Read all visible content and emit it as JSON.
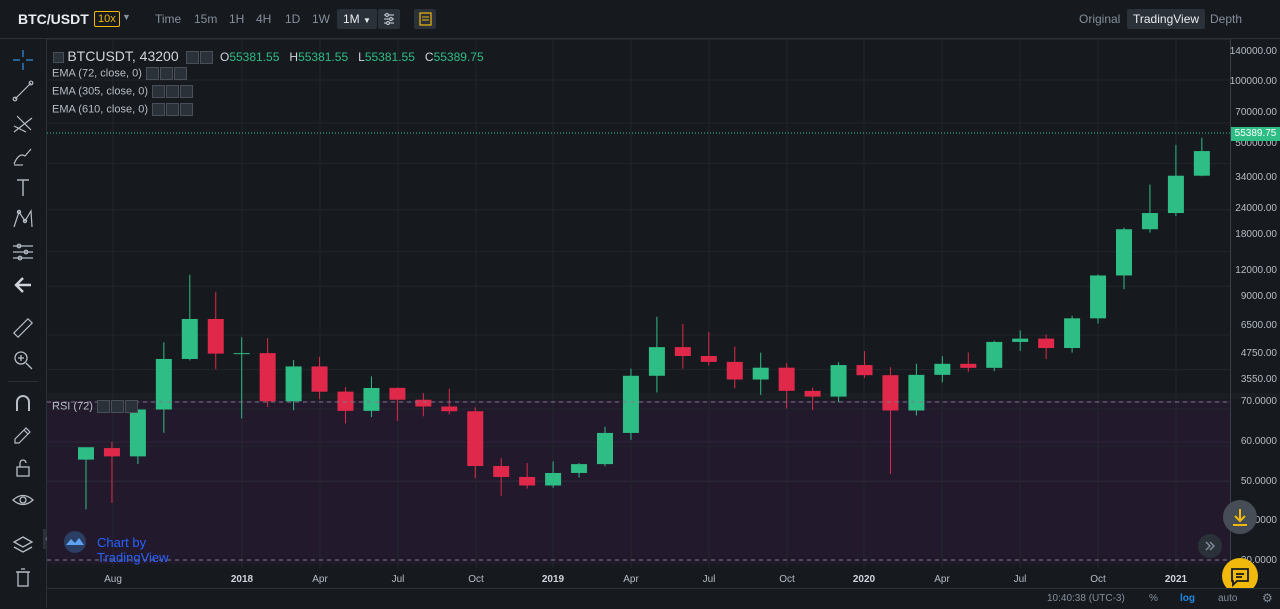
{
  "header": {
    "pair": "BTC/USDT",
    "leverage": "10x",
    "intervals": [
      "Time",
      "15m",
      "1H",
      "4H",
      "1D",
      "1W"
    ],
    "active_interval": "1M",
    "views": [
      "Original",
      "TradingView",
      "Depth"
    ],
    "active_view": "TradingView"
  },
  "legend": {
    "symbol": "BTCUSDT, 43200",
    "o_label": "O",
    "o_value": "55381.55",
    "h_label": "H",
    "h_value": "55381.55",
    "l_label": "L",
    "l_value": "55381.55",
    "c_label": "C",
    "c_value": "55389.75",
    "ema1": "EMA (72, close, 0)",
    "ema2": "EMA (305, close, 0)",
    "ema3": "EMA (610, close, 0)",
    "rsi": "RSI (72)"
  },
  "price_axis": [
    "140000.00",
    "100000.00",
    "70000.00",
    "50000.00",
    "34000.00",
    "24000.00",
    "18000.00",
    "12000.00",
    "9000.00",
    "6500.00",
    "4750.00",
    "3550.00"
  ],
  "current_price": "55389.75",
  "rsi_axis": [
    "70.0000",
    "60.0000",
    "50.0000",
    "40.0000"
  ],
  "rsi_hidden_label": "30.0000",
  "time_axis": [
    {
      "label": "Aug",
      "bold": false
    },
    {
      "label": "2018",
      "bold": true
    },
    {
      "label": "Apr",
      "bold": false
    },
    {
      "label": "Jul",
      "bold": false
    },
    {
      "label": "Oct",
      "bold": false
    },
    {
      "label": "2019",
      "bold": true
    },
    {
      "label": "Apr",
      "bold": false
    },
    {
      "label": "Jul",
      "bold": false
    },
    {
      "label": "Oct",
      "bold": false
    },
    {
      "label": "2020",
      "bold": true
    },
    {
      "label": "Apr",
      "bold": false
    },
    {
      "label": "Jul",
      "bold": false
    },
    {
      "label": "Oct",
      "bold": false
    },
    {
      "label": "2021",
      "bold": true
    }
  ],
  "watermark": "Chart by TradingView",
  "status": {
    "time": "10:40:38 (UTC-3)",
    "percent": "%",
    "log": "log",
    "auto": "auto"
  },
  "colors": {
    "up": "#2ebd85",
    "down": "#e0294a",
    "accent": "#f0b90b"
  },
  "chart_data": {
    "type": "candlestick",
    "symbol": "BTCUSDT",
    "interval": "1M",
    "scale": "log",
    "candles": [
      {
        "t": "2017-08",
        "o": 4261,
        "h": 4485,
        "l": 2817,
        "c": 4724
      },
      {
        "t": "2017-09",
        "o": 4690,
        "h": 4939,
        "l": 2972,
        "c": 4378
      },
      {
        "t": "2017-10",
        "o": 4378,
        "h": 6470,
        "l": 4110,
        "c": 6463
      },
      {
        "t": "2017-11",
        "o": 6463,
        "h": 11300,
        "l": 5325,
        "c": 9838
      },
      {
        "t": "2017-12",
        "o": 9838,
        "h": 19798,
        "l": 9722,
        "c": 13716
      },
      {
        "t": "2018-01",
        "o": 13716,
        "h": 17176,
        "l": 9035,
        "c": 10285
      },
      {
        "t": "2018-02",
        "o": 10285,
        "h": 11786,
        "l": 6000,
        "c": 10326
      },
      {
        "t": "2018-03",
        "o": 10326,
        "h": 11710,
        "l": 6600,
        "c": 6923
      },
      {
        "t": "2018-04",
        "o": 6922,
        "h": 9759,
        "l": 6430,
        "c": 9246
      },
      {
        "t": "2018-05",
        "o": 9246,
        "h": 10020,
        "l": 7032,
        "c": 7494
      },
      {
        "t": "2018-06",
        "o": 7500,
        "h": 7786,
        "l": 5755,
        "c": 6391
      },
      {
        "t": "2018-07",
        "o": 6391,
        "h": 8507,
        "l": 6070,
        "c": 7730
      },
      {
        "t": "2018-08",
        "o": 7735,
        "h": 7760,
        "l": 5880,
        "c": 7011
      },
      {
        "t": "2018-09",
        "o": 7011,
        "h": 7410,
        "l": 6111,
        "c": 6626
      },
      {
        "t": "2018-10",
        "o": 6626,
        "h": 7680,
        "l": 6205,
        "c": 6371
      },
      {
        "t": "2018-11",
        "o": 6370,
        "h": 6586,
        "l": 3652,
        "c": 4041
      },
      {
        "t": "2018-12",
        "o": 4041,
        "h": 4311,
        "l": 3156,
        "c": 3689
      },
      {
        "t": "2019-01",
        "o": 3690,
        "h": 4140,
        "l": 3349,
        "c": 3437
      },
      {
        "t": "2019-02",
        "o": 3437,
        "h": 4198,
        "l": 3373,
        "c": 3813
      },
      {
        "t": "2019-03",
        "o": 3814,
        "h": 4140,
        "l": 3670,
        "c": 4105
      },
      {
        "t": "2019-04",
        "o": 4105,
        "h": 5600,
        "l": 4034,
        "c": 5320
      },
      {
        "t": "2019-05",
        "o": 5320,
        "h": 9074,
        "l": 5025,
        "c": 8555
      },
      {
        "t": "2019-06",
        "o": 8555,
        "h": 13970,
        "l": 7444,
        "c": 10854
      },
      {
        "t": "2019-07",
        "o": 10854,
        "h": 13174,
        "l": 9071,
        "c": 10085
      },
      {
        "t": "2019-08",
        "o": 10085,
        "h": 12325,
        "l": 9320,
        "c": 9600
      },
      {
        "t": "2019-09",
        "o": 9600,
        "h": 10905,
        "l": 7710,
        "c": 8293
      },
      {
        "t": "2019-10",
        "o": 8293,
        "h": 10370,
        "l": 7300,
        "c": 9150
      },
      {
        "t": "2019-11",
        "o": 9150,
        "h": 9505,
        "l": 6515,
        "c": 7546
      },
      {
        "t": "2019-12",
        "o": 7546,
        "h": 7750,
        "l": 6435,
        "c": 7196
      },
      {
        "t": "2020-01",
        "o": 7196,
        "h": 9578,
        "l": 6871,
        "c": 9352
      },
      {
        "t": "2020-02",
        "o": 9352,
        "h": 10500,
        "l": 8410,
        "c": 8599
      },
      {
        "t": "2020-03",
        "o": 8599,
        "h": 9188,
        "l": 3782,
        "c": 6410
      },
      {
        "t": "2020-04",
        "o": 6410,
        "h": 9460,
        "l": 6150,
        "c": 8620
      },
      {
        "t": "2020-05",
        "o": 8620,
        "h": 10067,
        "l": 8105,
        "c": 9448
      },
      {
        "t": "2020-06",
        "o": 9448,
        "h": 10380,
        "l": 8833,
        "c": 9138
      },
      {
        "t": "2020-07",
        "o": 9138,
        "h": 11444,
        "l": 8893,
        "c": 11335
      },
      {
        "t": "2020-08",
        "o": 11335,
        "h": 12468,
        "l": 10525,
        "c": 11649
      },
      {
        "t": "2020-09",
        "o": 11649,
        "h": 12050,
        "l": 9825,
        "c": 10776
      },
      {
        "t": "2020-10",
        "o": 10776,
        "h": 14100,
        "l": 10374,
        "c": 13791
      },
      {
        "t": "2020-11",
        "o": 13791,
        "h": 19863,
        "l": 13195,
        "c": 19695
      },
      {
        "t": "2020-12",
        "o": 19695,
        "h": 29300,
        "l": 17572,
        "c": 28923
      },
      {
        "t": "2021-01",
        "o": 28923,
        "h": 41950,
        "l": 28130,
        "c": 33092
      },
      {
        "t": "2021-02",
        "o": 33092,
        "h": 58352,
        "l": 32296,
        "c": 45137
      },
      {
        "t": "2021-03",
        "o": 45134,
        "h": 61844,
        "l": 44950,
        "c": 55389.75
      }
    ],
    "rsi_range": [
      30,
      70
    ]
  }
}
